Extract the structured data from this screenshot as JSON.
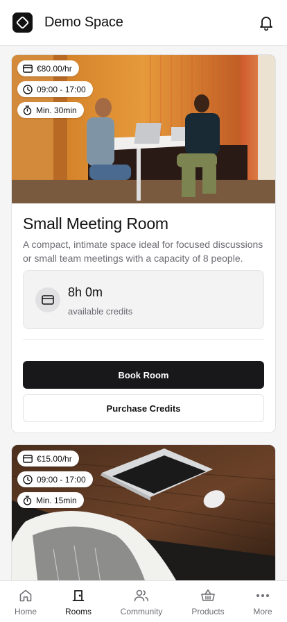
{
  "header": {
    "title": "Demo Space",
    "logo_icon": "diamond-logo-icon",
    "notification_icon": "bell-icon"
  },
  "rooms": [
    {
      "price": "€80.00/hr",
      "hours": "09:00 - 17:00",
      "min_booking": "Min. 30min",
      "name": "Small Meeting Room",
      "description": "A compact, intimate space ideal for focused discussions or small team meetings with a capacity of 8 people.",
      "credits_value": "8h 0m",
      "credits_label": "available credits",
      "book_label": "Book Room",
      "purchase_label": "Purchase Credits"
    },
    {
      "price": "€15.00/hr",
      "hours": "09:00 - 17:00",
      "min_booking": "Min. 15min"
    }
  ],
  "tabbar": {
    "active": "Rooms",
    "items": [
      {
        "label": "Home",
        "icon": "home-icon"
      },
      {
        "label": "Rooms",
        "icon": "door-icon"
      },
      {
        "label": "Community",
        "icon": "users-icon"
      },
      {
        "label": "Products",
        "icon": "basket-icon"
      },
      {
        "label": "More",
        "icon": "more-dots-icon"
      }
    ]
  },
  "colors": {
    "primary_button": "#18181b",
    "background": "#f5f5f6",
    "muted_text": "#6b6b73"
  }
}
